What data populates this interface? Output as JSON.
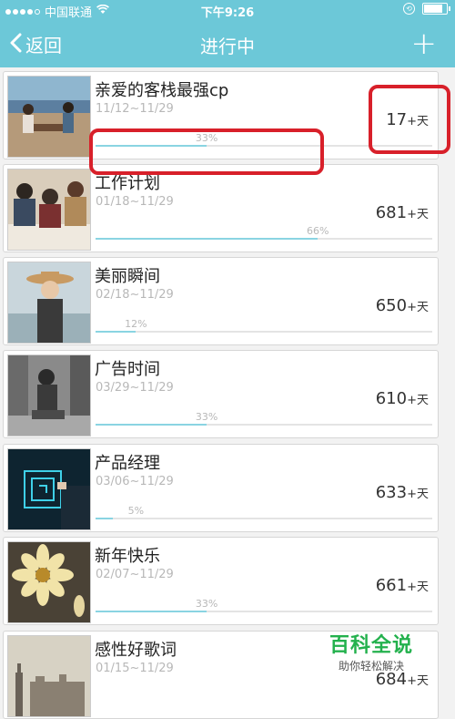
{
  "status": {
    "carrier": "中国联通",
    "time": "下午9:26"
  },
  "nav": {
    "back_label": "返回",
    "title": "进行中",
    "add": "+"
  },
  "items": [
    {
      "title": "亲爱的客栈最强cp",
      "dates": "11/12~11/29",
      "days": "17",
      "unit": "+天",
      "percent_label": "33%",
      "progress": 0.33
    },
    {
      "title": "工作计划",
      "dates": "01/18~11/29",
      "days": "681",
      "unit": "+天",
      "percent_label": "66%",
      "progress": 0.66
    },
    {
      "title": "美丽瞬间",
      "dates": "02/18~11/29",
      "days": "650",
      "unit": "+天",
      "percent_label": "12%",
      "progress": 0.12
    },
    {
      "title": "广告时间",
      "dates": "03/29~11/29",
      "days": "610",
      "unit": "+天",
      "percent_label": "33%",
      "progress": 0.33
    },
    {
      "title": "产品经理",
      "dates": "03/06~11/29",
      "days": "633",
      "unit": "+天",
      "percent_label": "5%",
      "progress": 0.05
    },
    {
      "title": "新年快乐",
      "dates": "02/07~11/29",
      "days": "661",
      "unit": "+天",
      "percent_label": "33%",
      "progress": 0.33
    },
    {
      "title": "感性好歌词",
      "dates": "01/15~11/29",
      "days": "684",
      "unit": "+天",
      "percent_label": "",
      "progress": 0.0
    }
  ],
  "watermark": {
    "title": "百科全说",
    "subtitle": "助你轻松解决"
  }
}
